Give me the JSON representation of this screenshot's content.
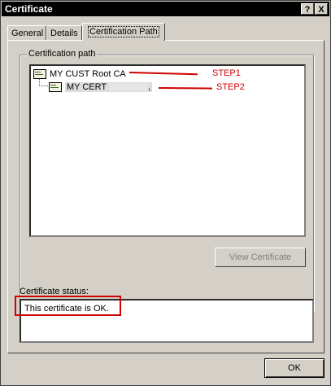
{
  "window": {
    "title": "Certificate",
    "help_btn": "?",
    "close_btn": "X"
  },
  "tabs": [
    {
      "label": "General"
    },
    {
      "label": "Details"
    },
    {
      "label": "Certification Path"
    }
  ],
  "cert_path": {
    "group_label": "Certification path",
    "nodes": [
      {
        "label": "MY CUST  Root CA",
        "icon": "certificate-icon"
      },
      {
        "label": "MY CERT",
        "suffix": ",",
        "icon": "certificate-icon"
      }
    ],
    "view_button": "View Certificate"
  },
  "status": {
    "label": "Certificate status:",
    "text": "This certificate is OK."
  },
  "ok_button": "OK",
  "annotations": {
    "step1": "STEP1",
    "step2": "STEP2",
    "color": "#d00000"
  }
}
